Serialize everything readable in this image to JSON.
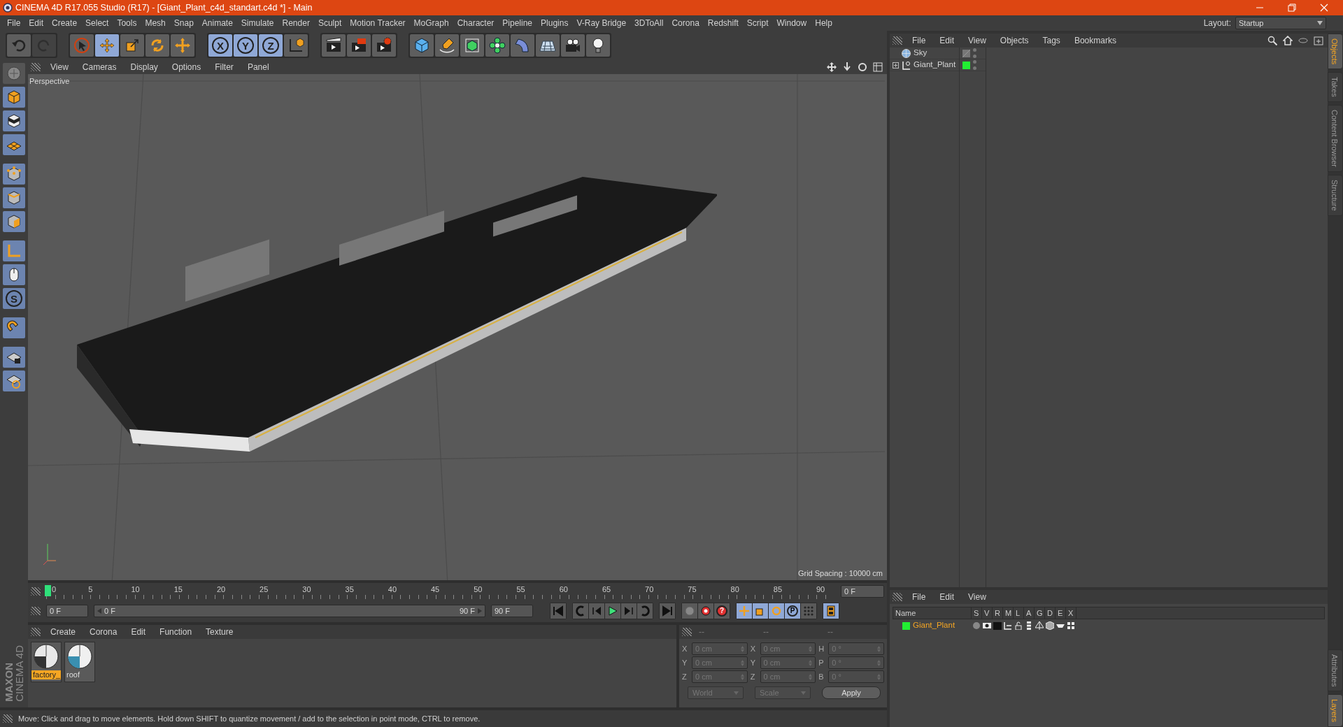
{
  "window": {
    "title": "CINEMA 4D R17.055 Studio (R17) - [Giant_Plant_c4d_standart.c4d *] - Main"
  },
  "menu": [
    "File",
    "Edit",
    "Create",
    "Select",
    "Tools",
    "Mesh",
    "Snap",
    "Animate",
    "Simulate",
    "Render",
    "Sculpt",
    "Motion Tracker",
    "MoGraph",
    "Character",
    "Pipeline",
    "Plugins",
    "V-Ray Bridge",
    "3DToAll",
    "Corona",
    "Redshift",
    "Script",
    "Window",
    "Help"
  ],
  "layout": {
    "label": "Layout:",
    "value": "Startup"
  },
  "toolbar": [
    {
      "tools": [
        {
          "selected": false,
          "disabled": false
        },
        {
          "selected": false,
          "disabled": true
        }
      ]
    },
    {
      "tools": [
        {
          "selected": false,
          "disabled": false
        },
        {
          "selected": true,
          "disabled": false
        },
        {
          "selected": false,
          "disabled": false
        },
        {
          "selected": false,
          "disabled": false
        },
        {
          "selected": false,
          "disabled": false
        }
      ]
    },
    {
      "tools": [
        {
          "label": "X",
          "selected": true,
          "disabled": false
        },
        {
          "label": "Y",
          "selected": true,
          "disabled": false
        },
        {
          "label": "Z",
          "selected": true,
          "disabled": false
        },
        {
          "selected": false,
          "disabled": false
        }
      ]
    },
    {
      "tools": [
        {
          "selected": false,
          "disabled": false
        },
        {
          "selected": false,
          "disabled": false
        },
        {
          "selected": false,
          "disabled": false
        }
      ]
    },
    {
      "tools": [
        {
          "selected": false,
          "disabled": false
        },
        {
          "selected": false,
          "disabled": false
        },
        {
          "selected": false,
          "disabled": false
        },
        {
          "selected": false,
          "disabled": false
        },
        {
          "selected": false,
          "disabled": false
        },
        {
          "selected": false,
          "disabled": false
        },
        {
          "selected": false,
          "disabled": false
        },
        {
          "selected": false,
          "disabled": false
        }
      ]
    }
  ],
  "left_toolbar": {
    "snap_label": "S"
  },
  "logo": {
    "brand": "MAXON",
    "product": "CINEMA 4D"
  },
  "viewport": {
    "menu": [
      "View",
      "Cameras",
      "Display",
      "Options",
      "Filter",
      "Panel"
    ],
    "camera": "Perspective",
    "grid_spacing": "Grid Spacing : 10000 cm"
  },
  "timeline": {
    "ruler": [
      "0",
      "5",
      "10",
      "15",
      "20",
      "25",
      "30",
      "35",
      "40",
      "45",
      "50",
      "55",
      "60",
      "65",
      "70",
      "75",
      "80",
      "85",
      "90"
    ],
    "playhead": {
      "level": 0
    },
    "current_frame": "0 F",
    "start": "0 F",
    "range": {
      "start": "0 F",
      "end": "90 F",
      "level": 1
    },
    "end": "90 F",
    "help_label": "?",
    "param_label": "P"
  },
  "materials": {
    "menu": [
      "Create",
      "Corona",
      "Edit",
      "Function",
      "Texture"
    ],
    "items": [
      {
        "name": "factory_",
        "selected": true
      },
      {
        "name": "roof",
        "selected": false
      }
    ]
  },
  "coordinates": {
    "headers": [
      "--",
      "--",
      "--"
    ],
    "rows": [
      {
        "pos_axis": "X",
        "pos": "0 cm",
        "size_axis": "X",
        "size": "0 cm",
        "rot_axis": "H",
        "rot": "0 °"
      },
      {
        "pos_axis": "Y",
        "pos": "0 cm",
        "size_axis": "Y",
        "size": "0 cm",
        "rot_axis": "P",
        "rot": "0 °"
      },
      {
        "pos_axis": "Z",
        "pos": "0 cm",
        "size_axis": "Z",
        "size": "0 cm",
        "rot_axis": "B",
        "rot": "0 °"
      }
    ],
    "dropdowns": [
      "World",
      "Scale"
    ],
    "apply": "Apply"
  },
  "status_bar": "Move: Click and drag to move elements. Hold down SHIFT to quantize movement / add to the selection in point mode, CTRL to remove.",
  "objects": {
    "menu": [
      "File",
      "Edit",
      "View",
      "Objects",
      "Tags",
      "Bookmarks"
    ],
    "items": [
      {
        "name": "Sky",
        "kind": "sky",
        "expandable": false
      },
      {
        "name": "Giant_Plant",
        "kind": "null",
        "expandable": true,
        "color": "#22ee33"
      }
    ]
  },
  "side_tabs_top": [
    {
      "label": "Objects",
      "selected": true
    },
    {
      "label": "Takes",
      "selected": false
    },
    {
      "label": "Content Browser",
      "selected": false
    },
    {
      "label": "Structure",
      "selected": false
    }
  ],
  "layers": {
    "menu": [
      "File",
      "Edit",
      "View"
    ],
    "columns": [
      "Name",
      "S",
      "V",
      "R",
      "M",
      "L",
      "A",
      "G",
      "D",
      "E",
      "X"
    ],
    "items": [
      {
        "name": "Giant_Plant",
        "color": "#22ee33"
      }
    ]
  },
  "side_tabs_bottom": [
    {
      "label": "Attributes",
      "selected": false
    },
    {
      "label": "Layers",
      "selected": true
    }
  ]
}
